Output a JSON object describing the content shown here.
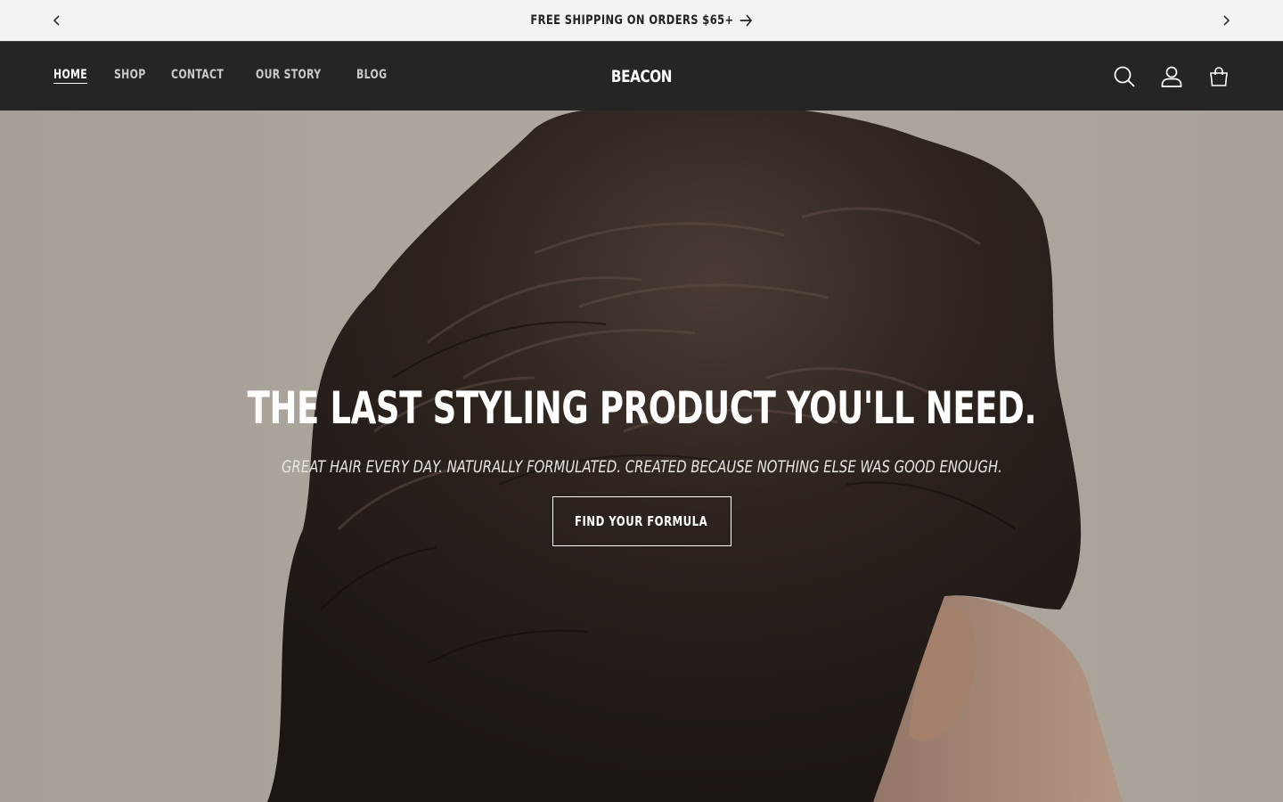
{
  "announcement": {
    "text": "FREE SHIPPING ON ORDERS $65+",
    "prev_icon": "chevron-left-icon",
    "next_icon": "chevron-right-icon",
    "link_icon": "arrow-right-icon"
  },
  "header": {
    "nav": [
      "HOME",
      "SHOP",
      "CONTACT",
      "OUR STORY",
      "BLOG"
    ],
    "active_nav": "HOME",
    "logo": "BEACON",
    "icons": [
      "search-icon",
      "account-icon",
      "cart-icon"
    ]
  },
  "hero": {
    "title": "THE LAST STYLING PRODUCT YOU'LL NEED.",
    "subtitle": "GREAT HAIR EVERY DAY. NATURALLY FORMULATED. CREATED BECAUSE NOTHING ELSE WAS GOOD ENOUGH.",
    "cta_label": "FIND YOUR FORMULA"
  },
  "colors": {
    "announcement_bg": "#f3f3f3",
    "header_bg": "#252525",
    "hero_bg": "#aba59c",
    "hair": "#2a211c"
  }
}
